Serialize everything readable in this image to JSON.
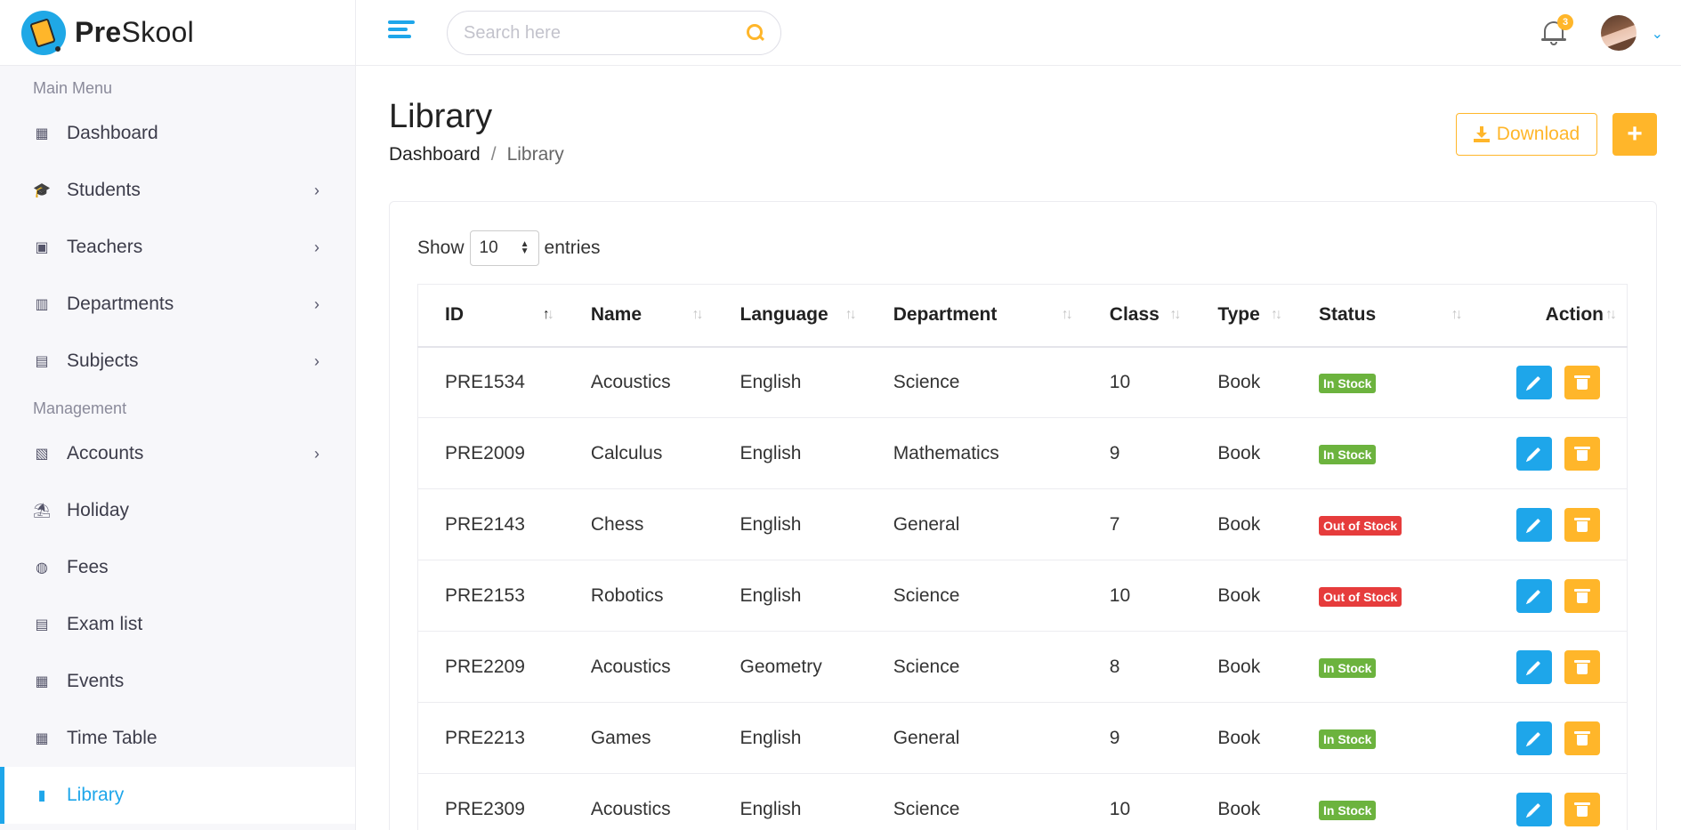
{
  "brand": {
    "name_bold": "Pre",
    "name_rest": "Skool"
  },
  "sidebar": {
    "section_main": "Main Menu",
    "section_management": "Management",
    "main_items": [
      {
        "label": "Dashboard",
        "icon": "dashboard-icon",
        "has_submenu": false
      },
      {
        "label": "Students",
        "icon": "student-icon",
        "has_submenu": true
      },
      {
        "label": "Teachers",
        "icon": "teacher-icon",
        "has_submenu": true
      },
      {
        "label": "Departments",
        "icon": "building-icon",
        "has_submenu": true
      },
      {
        "label": "Subjects",
        "icon": "book-reader-icon",
        "has_submenu": true
      }
    ],
    "management_items": [
      {
        "label": "Accounts",
        "icon": "invoice-icon",
        "has_submenu": true
      },
      {
        "label": "Holiday",
        "icon": "holiday-icon",
        "has_submenu": false
      },
      {
        "label": "Fees",
        "icon": "fees-icon",
        "has_submenu": false
      },
      {
        "label": "Exam list",
        "icon": "clipboard-icon",
        "has_submenu": false
      },
      {
        "label": "Events",
        "icon": "calendar-icon",
        "has_submenu": false
      },
      {
        "label": "Time Table",
        "icon": "table-icon",
        "has_submenu": false
      },
      {
        "label": "Library",
        "icon": "library-book-icon",
        "has_submenu": false,
        "active": true
      }
    ]
  },
  "header": {
    "search_placeholder": "Search here",
    "notification_count": "3"
  },
  "page": {
    "title": "Library",
    "breadcrumb_home": "Dashboard",
    "breadcrumb_sep": "/",
    "breadcrumb_current": "Library",
    "download_label": "Download",
    "add_label": "+"
  },
  "table": {
    "show_label": "Show",
    "entries_value": "10",
    "entries_label": "entries",
    "columns": [
      "ID",
      "Name",
      "Language",
      "Department",
      "Class",
      "Type",
      "Status",
      "Action"
    ],
    "rows": [
      {
        "id": "PRE1534",
        "name": "Acoustics",
        "language": "English",
        "department": "Science",
        "class": "10",
        "type": "Book",
        "status": "In Stock"
      },
      {
        "id": "PRE2009",
        "name": "Calculus",
        "language": "English",
        "department": "Mathematics",
        "class": "9",
        "type": "Book",
        "status": "In Stock"
      },
      {
        "id": "PRE2143",
        "name": "Chess",
        "language": "English",
        "department": "General",
        "class": "7",
        "type": "Book",
        "status": "Out of Stock"
      },
      {
        "id": "PRE2153",
        "name": "Robotics",
        "language": "English",
        "department": "Science",
        "class": "10",
        "type": "Book",
        "status": "Out of Stock"
      },
      {
        "id": "PRE2209",
        "name": "Acoustics",
        "language": "Geometry",
        "department": "Science",
        "class": "8",
        "type": "Book",
        "status": "In Stock"
      },
      {
        "id": "PRE2213",
        "name": "Games",
        "language": "English",
        "department": "General",
        "class": "9",
        "type": "Book",
        "status": "In Stock"
      },
      {
        "id": "PRE2309",
        "name": "Acoustics",
        "language": "English",
        "department": "Science",
        "class": "10",
        "type": "Book",
        "status": "In Stock"
      }
    ]
  },
  "colors": {
    "primary": "#1ea6ea",
    "accent": "#ffb62a",
    "in_stock": "#6cb33e",
    "out_of_stock": "#e63c3c"
  }
}
